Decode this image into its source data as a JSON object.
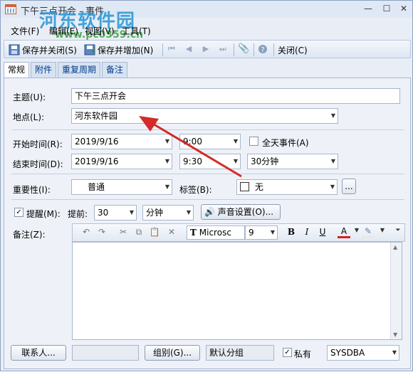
{
  "window": {
    "title": "下午三点开会 - 事件"
  },
  "watermark": {
    "text": "河东软件园",
    "url": "www.pc0359.cn"
  },
  "menu": [
    {
      "label": "文件(F)"
    },
    {
      "label": "编辑(E)"
    },
    {
      "label": "视图(V)"
    },
    {
      "label": "工具(T)"
    }
  ],
  "toolbar": {
    "save_close": "保存并关闭(S)",
    "save_add": "保存并增加(N)",
    "close": "关闭(C)"
  },
  "tabs": [
    "常规",
    "附件",
    "重复周期",
    "备注"
  ],
  "form": {
    "subject_label": "主题(U):",
    "subject_value": "下午三点开会",
    "location_label": "地点(L):",
    "location_value": "河东软件园",
    "start_label": "开始时间(R):",
    "start_date": "2019/9/16",
    "start_time": "9:00",
    "allday_label": "全天事件(A)",
    "end_label": "结束时间(D):",
    "end_date": "2019/9/16",
    "end_time": "9:30",
    "duration": "30分钟",
    "importance_label": "重要性(I):",
    "importance_value": "普通",
    "tag_label": "标签(B):",
    "tag_value": "无",
    "tag_more": "...",
    "reminder_label": "提醒(M):",
    "advance_label": "提前:",
    "advance_value": "30",
    "advance_unit": "分钟",
    "sound_button": "声音设置(O)...",
    "note_label": "备注(Z):",
    "font_name": "Microsc",
    "font_size": "9",
    "contacts_button": "联系人...",
    "group_button": "组别(G)...",
    "group_value": "默认分组",
    "private_label": "私有",
    "owner_value": "SYSDBA"
  }
}
